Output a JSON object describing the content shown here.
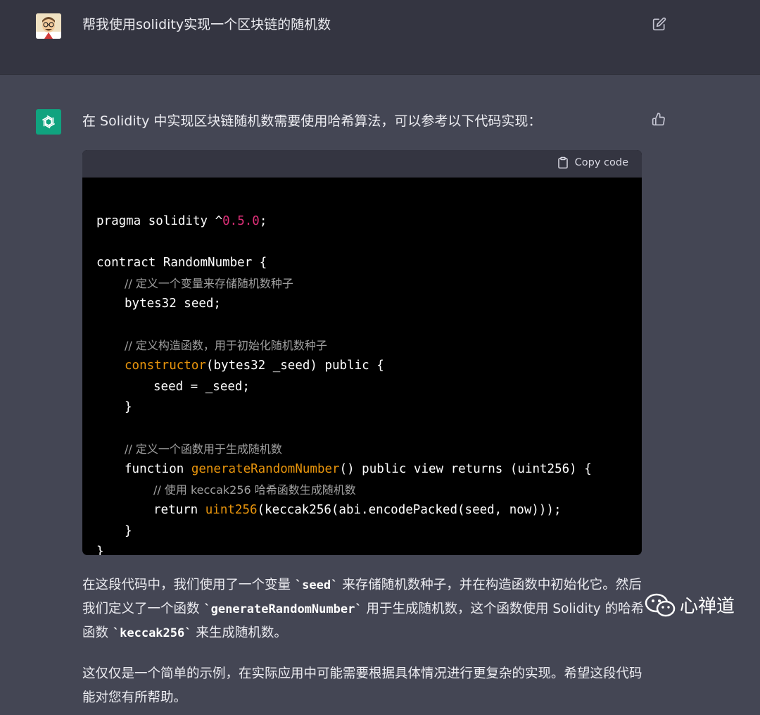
{
  "user_message": {
    "text": "帮我使用solidity实现一个区块链的随机数",
    "avatar_icon": "user-avatar-photo",
    "edit_icon": "edit-icon"
  },
  "assistant_message": {
    "intro": "在 Solidity 中实现区块链随机数需要使用哈希算法，可以参考以下代码实现：",
    "feedback_icon": "thumbs-up-icon",
    "code_block": {
      "copy_label": "Copy code",
      "lines": {
        "l1_a": "pragma solidity ^",
        "l1_num": "0.5.0",
        "l1_b": ";",
        "l3": "contract RandomNumber {",
        "l4": "// 定义一个变量来存储随机数种子",
        "l5": "bytes32 seed;",
        "l7": "// 定义构造函数，用于初始化随机数种子",
        "l8_fn": "constructor",
        "l8_b": "(bytes32 _seed) public {",
        "l9": "seed = _seed;",
        "l10": "}",
        "l12": "// 定义一个函数用于生成随机数",
        "l13_a": "function ",
        "l13_fn": "generateRandomNumber",
        "l13_b": "() public view returns (uint256) {",
        "l14": "// 使用 keccak256 哈希函数生成随机数",
        "l15_a": "return ",
        "l15_fn": "uint256",
        "l15_b": "(keccak256(abi.encodePacked(seed, now)));",
        "l16": "}",
        "l17": "}"
      }
    },
    "para1": {
      "t1": "在这段代码中，我们使用了一个变量 ",
      "c1": "`seed`",
      "t2": " 来存储随机数种子，并在构造函数中初始化它。然后我们定义了一个函数 ",
      "c2": "`generateRandomNumber`",
      "t3": " 用于生成随机数，这个函数使用 Solidity 的哈希函数 ",
      "c3": "`keccak256`",
      "t4": " 来生成随机数。"
    },
    "para2": "这仅仅是一个简单的示例，在实际应用中可能需要根据具体情况进行更复杂的实现。希望这段代码能对您有所帮助。"
  },
  "watermark": {
    "text": "心禅道",
    "icon": "wechat-icon"
  },
  "colors": {
    "user_bg": "#343541",
    "assistant_bg": "#444654",
    "code_bg": "#000000",
    "code_header_bg": "#343541",
    "brand_green": "#10a37f",
    "number_pink": "#df3079",
    "function_orange": "#e9950c"
  }
}
